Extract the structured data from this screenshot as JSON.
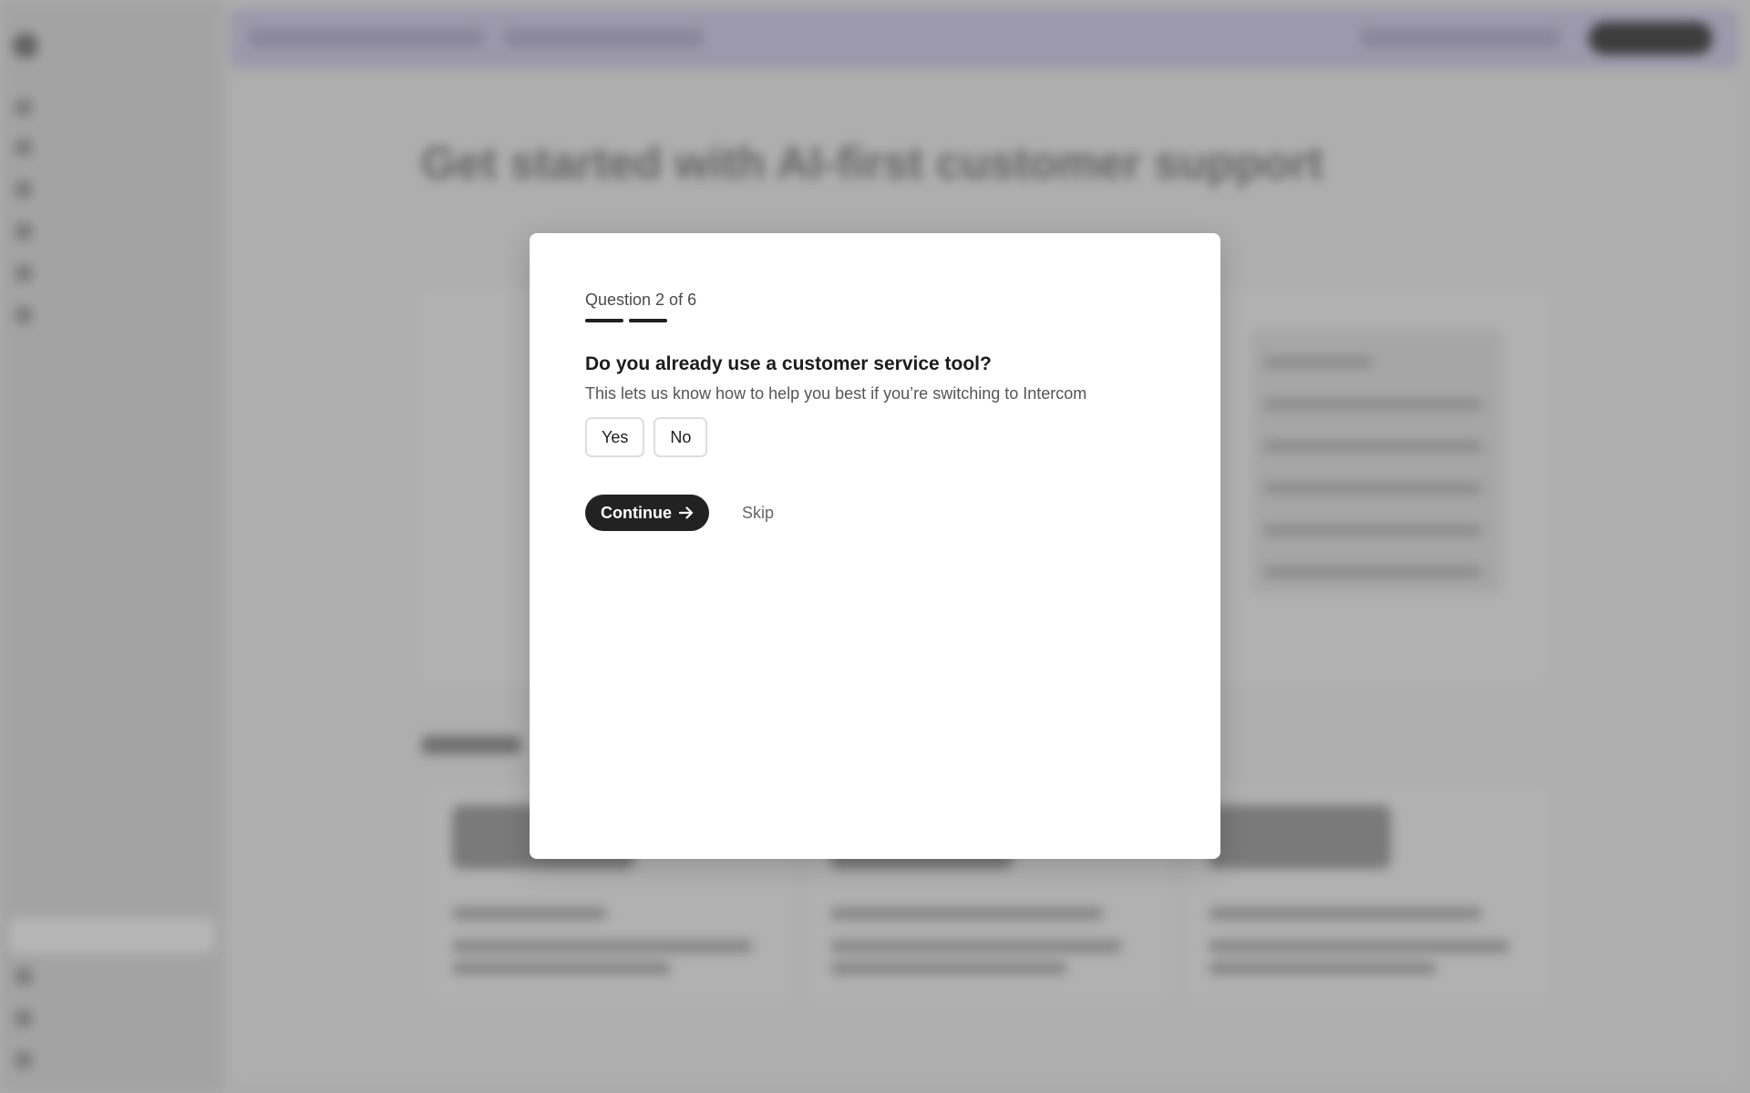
{
  "modal": {
    "progress_label": "Question 2 of 6",
    "progress": {
      "current": 2,
      "total": 6
    },
    "question": "Do you already use a customer service tool?",
    "subtitle": "This lets us know how to help you best if you’re switching to Intercom",
    "options": [
      {
        "label": "Yes"
      },
      {
        "label": "No"
      }
    ],
    "continue_label": "Continue",
    "continue_icon": "arrow-right-icon",
    "skip_label": "Skip"
  },
  "background": {
    "page_title": "Get started with AI-first customer support"
  },
  "colors": {
    "primary_button": "#222222",
    "progress_fill": "#1f1f1f",
    "topbar_tint": "#a3a0b6"
  }
}
